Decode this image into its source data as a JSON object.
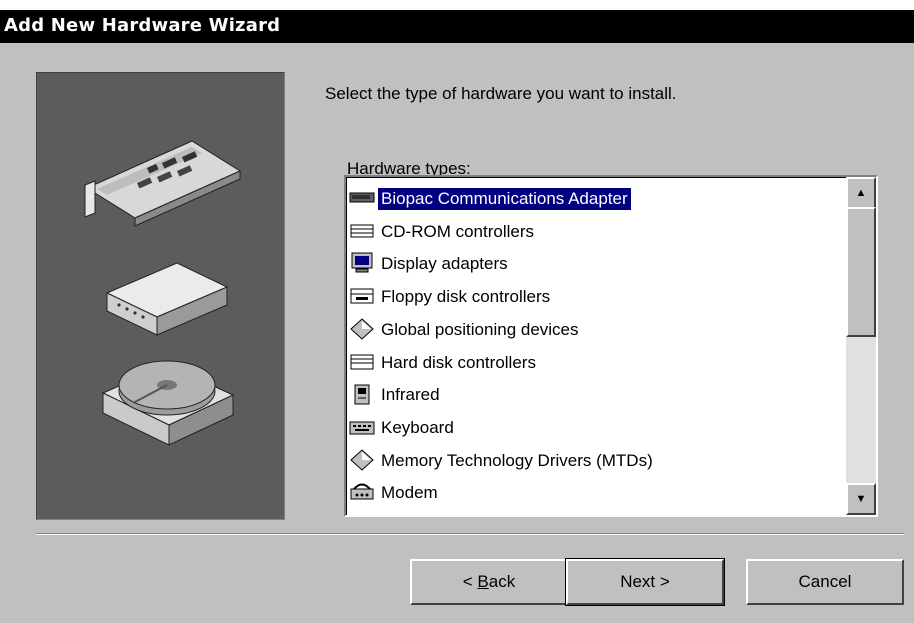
{
  "window": {
    "title": "Add New Hardware Wizard"
  },
  "instruction": "Select the type of hardware you want to install.",
  "hardware_types": {
    "label_accel": "H",
    "label_rest": "ardware types:",
    "selected_index": 0,
    "items": [
      {
        "label": "Biopac Communications Adapter",
        "icon": "adapter-card-icon"
      },
      {
        "label": "CD-ROM controllers",
        "icon": "cdrom-controller-icon"
      },
      {
        "label": "Display adapters",
        "icon": "monitor-icon"
      },
      {
        "label": "Floppy disk controllers",
        "icon": "floppy-controller-icon"
      },
      {
        "label": "Global positioning devices",
        "icon": "diamond-icon"
      },
      {
        "label": "Hard disk controllers",
        "icon": "disk-controller-icon"
      },
      {
        "label": "Infrared",
        "icon": "infrared-icon"
      },
      {
        "label": "Keyboard",
        "icon": "keyboard-icon"
      },
      {
        "label": "Memory Technology Drivers (MTDs)",
        "icon": "diamond-icon"
      },
      {
        "label": "Modem",
        "icon": "modem-icon"
      }
    ]
  },
  "scrollbar": {
    "up_glyph": "▲",
    "down_glyph": "▼"
  },
  "buttons": {
    "back_prefix": "< ",
    "back_accel": "B",
    "back_rest": "ack",
    "next": "Next >",
    "cancel": "Cancel"
  },
  "colors": {
    "dialog_face": "#c0c0c0",
    "title_bar": "#000000",
    "selection": "#000080",
    "art_panel": "#5c5c5c"
  }
}
